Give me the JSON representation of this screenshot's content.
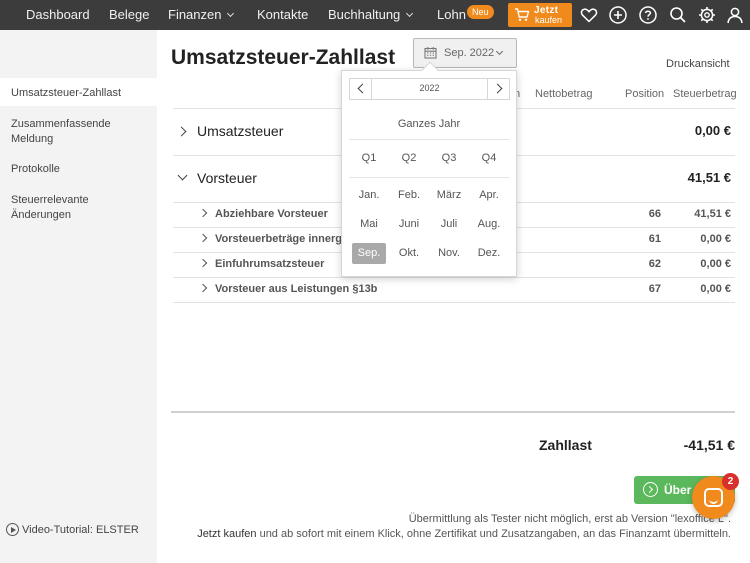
{
  "nav": {
    "items": [
      {
        "label": "Dashboard",
        "dropdown": false
      },
      {
        "label": "Belege",
        "dropdown": false
      },
      {
        "label": "Finanzen",
        "dropdown": true
      },
      {
        "label": "Kontakte",
        "dropdown": false
      },
      {
        "label": "Buchhaltung",
        "dropdown": true
      },
      {
        "label": "Lohn",
        "dropdown": false
      }
    ],
    "lohn_badge": "Neu",
    "buy_line1": "Jetzt",
    "buy_line2": "kaufen",
    "icons": [
      "cart-icon",
      "heart-icon",
      "plus-circle-icon",
      "help-icon",
      "search-icon",
      "settings-icon",
      "user-icon"
    ]
  },
  "sidebar": {
    "items": [
      {
        "label": "Umsatzsteuer-Zahllast",
        "active": true
      },
      {
        "label": "Zusammenfassende Meldung",
        "active": false
      },
      {
        "label": "Protokolle",
        "active": false
      },
      {
        "label": "Steuerrelevante Änderungen",
        "active": false
      }
    ],
    "video_link": "Video-Tutorial: ELSTER"
  },
  "page": {
    "title": "Umsatzsteuer-Zahllast",
    "period_button": "Sep. 2022",
    "print_view": "Druckansicht",
    "columns": {
      "partial": "n",
      "net": "Nettobetrag",
      "position": "Position",
      "tax": "Steuerbetrag"
    }
  },
  "sections": [
    {
      "label": "Umsatzsteuer",
      "value": "0,00 €",
      "expanded": false
    },
    {
      "label": "Vorsteuer",
      "value": "41,51 €",
      "expanded": true
    }
  ],
  "vorsteuer_rows": [
    {
      "label": "Abziehbare Vorsteuer",
      "position": "66",
      "amount": "41,51 €"
    },
    {
      "label": "Vorsteuerbeträge innerg",
      "position": "61",
      "amount": "0,00 €"
    },
    {
      "label": "Einfuhrumsatzsteuer",
      "position": "62",
      "amount": "0,00 €"
    },
    {
      "label": "Vorsteuer aus Leistungen §13b",
      "position": "67",
      "amount": "0,00 €"
    }
  ],
  "total": {
    "label": "Zahllast",
    "value": "-41,51 €"
  },
  "send_button": "Über",
  "notes": {
    "line1": "Übermittlung als Tester nicht möglich, erst ab Version \"lexoffice L\".",
    "line2_link": "Jetzt kaufen",
    "line2_rest": " und ab sofort mit einem Klick, ohne Zertifikat und Zusatzangaben, an das Finanzamt übermitteln."
  },
  "chat": {
    "badge": "2"
  },
  "period_picker": {
    "year": "2022",
    "whole_year": "Ganzes Jahr",
    "quarters": [
      "Q1",
      "Q2",
      "Q3",
      "Q4"
    ],
    "months": [
      "Jan.",
      "Feb.",
      "März",
      "Apr.",
      "Mai",
      "Juni",
      "Juli",
      "Aug.",
      "Sep.",
      "Okt.",
      "Nov.",
      "Dez."
    ],
    "selected_month": "Sep."
  },
  "colors": {
    "nav_bg": "#3c3c3c",
    "accent": "#f08a1c",
    "send_green": "#5cb85c",
    "selected": "#a9a9a9"
  }
}
